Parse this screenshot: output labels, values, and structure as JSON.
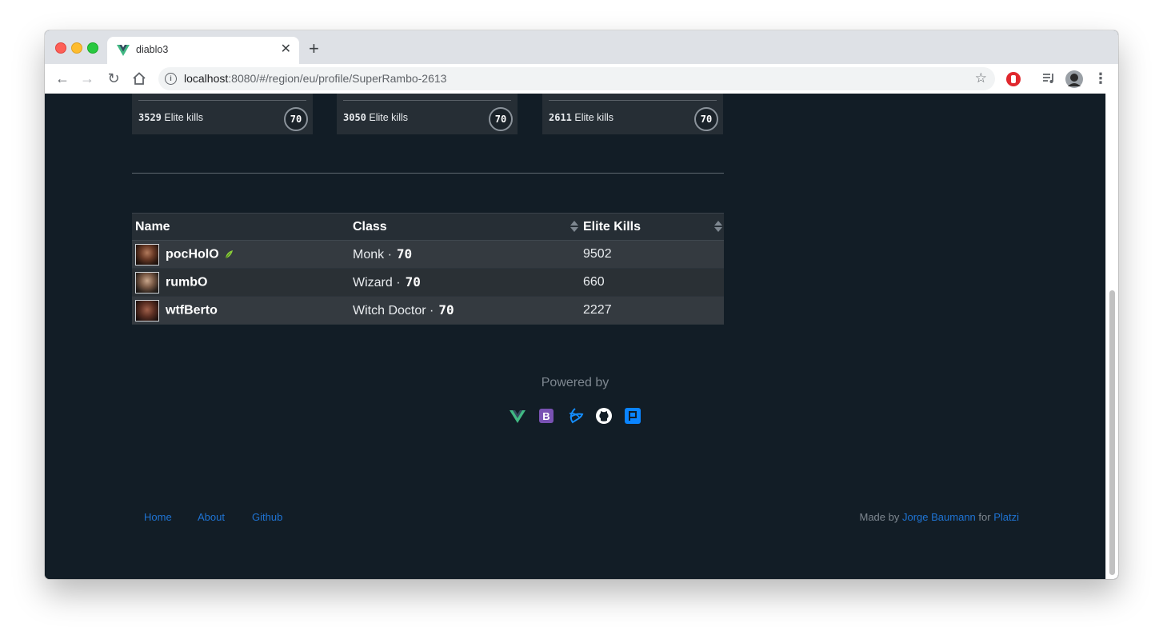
{
  "browser": {
    "tab_title": "diablo3",
    "url_host": "localhost",
    "url_rest": ":8080/#/region/eu/profile/SuperRambo-2613"
  },
  "heroes": [
    {
      "kills": "3529",
      "kills_label": "Elite kills",
      "level": "70"
    },
    {
      "kills": "3050",
      "kills_label": "Elite kills",
      "level": "70"
    },
    {
      "kills": "2611",
      "kills_label": "Elite kills",
      "level": "70"
    }
  ],
  "table": {
    "headers": {
      "name": "Name",
      "class": "Class",
      "kills": "Elite Kills"
    },
    "rows": [
      {
        "name": "pocHolO",
        "class": "Monk ·",
        "level": "70",
        "kills": "9502"
      },
      {
        "name": "rumbO",
        "class": "Wizard ·",
        "level": "70",
        "kills": "660"
      },
      {
        "name": "wtfBerto",
        "class": "Witch Doctor ·",
        "level": "70",
        "kills": "2227"
      }
    ]
  },
  "powered_by": {
    "label": "Powered by",
    "icons": [
      "vue-icon",
      "bootstrap-icon",
      "battlenet-icon",
      "github-icon",
      "platzi-icon"
    ]
  },
  "footer": {
    "links": {
      "home": "Home",
      "about": "About",
      "github": "Github"
    },
    "made_by": "Made by",
    "author": "Jorge Baumann",
    "for": "for",
    "platzi": "Platzi"
  },
  "colors": {
    "page_bg": "#121d26",
    "card_bg": "#262e35",
    "link": "#1f74d4"
  }
}
